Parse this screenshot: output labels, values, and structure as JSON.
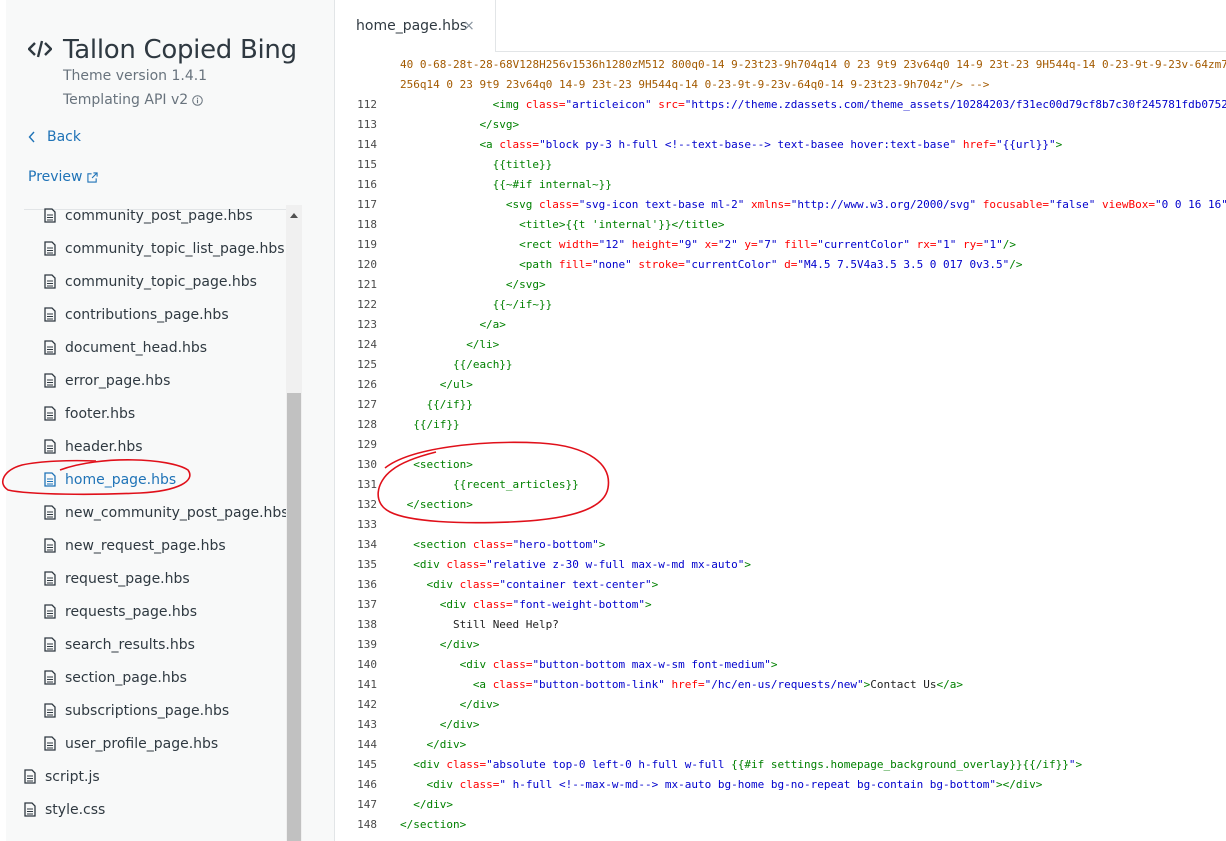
{
  "sidebar": {
    "theme_name": "Tallon Copied Bing",
    "version": "Theme version 1.4.1",
    "api": "Templating API v2",
    "back": "Back",
    "preview": "Preview",
    "files": [
      {
        "name": "community_post_page.hbs"
      },
      {
        "name": "community_topic_list_page.hbs"
      },
      {
        "name": "community_topic_page.hbs"
      },
      {
        "name": "contributions_page.hbs"
      },
      {
        "name": "document_head.hbs"
      },
      {
        "name": "error_page.hbs"
      },
      {
        "name": "footer.hbs"
      },
      {
        "name": "header.hbs"
      },
      {
        "name": "home_page.hbs",
        "selected": true
      },
      {
        "name": "new_community_post_page.hbs"
      },
      {
        "name": "new_request_page.hbs"
      },
      {
        "name": "request_page.hbs"
      },
      {
        "name": "requests_page.hbs"
      },
      {
        "name": "search_results.hbs"
      },
      {
        "name": "section_page.hbs"
      },
      {
        "name": "subscriptions_page.hbs"
      },
      {
        "name": "user_profile_page.hbs"
      }
    ],
    "root_files": [
      {
        "name": "script.js"
      },
      {
        "name": "style.css"
      }
    ]
  },
  "tabs": [
    {
      "label": "home_page.hbs",
      "close": "×"
    }
  ],
  "editor": {
    "lines": [
      {
        "n": "",
        "indent": 0,
        "tokens": [
          [
            "cmt",
            "40 0-68-28t-28-68V128H256v1536h1280zM512 800q0-14 9-23t23-9h704q14 0 23 9t9 23v64q0 14-9 23t-23 9H544q-14 0-23-9t-9-23v-64zm7"
          ]
        ]
      },
      {
        "n": "",
        "indent": 0,
        "tokens": [
          [
            "cmt",
            "256q14 0 23 9t9 23v64q0 14-9 23t-23 9H544q-14 0-23-9t-9-23v-64q0-14 9-23t23-9h704z\"/> -->"
          ]
        ]
      },
      {
        "n": "112",
        "indent": 14,
        "tokens": [
          [
            "tag",
            "<img "
          ],
          [
            "attr",
            "class="
          ],
          [
            "str",
            "\"articleicon\""
          ],
          [
            "txt",
            " "
          ],
          [
            "attr",
            "src="
          ],
          [
            "str",
            "\"https://theme.zdassets.com/theme_assets/10284203/f31ec00d79cf8b7c30f245781fdb0752"
          ]
        ]
      },
      {
        "n": "113",
        "indent": 12,
        "tokens": [
          [
            "tag",
            "</svg>"
          ]
        ]
      },
      {
        "n": "114",
        "indent": 12,
        "tokens": [
          [
            "tag",
            "<a "
          ],
          [
            "attr",
            "class="
          ],
          [
            "str",
            "\"block py-3 h-full <!--text-base--> text-basee hover:text-base\""
          ],
          [
            "txt",
            " "
          ],
          [
            "attr",
            "href="
          ],
          [
            "str",
            "\"{{url}}\""
          ],
          [
            "tag",
            ">"
          ]
        ]
      },
      {
        "n": "115",
        "indent": 14,
        "tokens": [
          [
            "hb",
            "{{title}}"
          ]
        ]
      },
      {
        "n": "116",
        "indent": 14,
        "tokens": [
          [
            "hb",
            "{{~#if internal~}}"
          ]
        ]
      },
      {
        "n": "117",
        "indent": 16,
        "tokens": [
          [
            "tag",
            "<svg "
          ],
          [
            "attr",
            "class="
          ],
          [
            "str",
            "\"svg-icon text-base ml-2\""
          ],
          [
            "txt",
            " "
          ],
          [
            "attr",
            "xmlns="
          ],
          [
            "str",
            "\"http://www.w3.org/2000/svg\""
          ],
          [
            "txt",
            " "
          ],
          [
            "attr",
            "focusable="
          ],
          [
            "str",
            "\"false\""
          ],
          [
            "txt",
            " "
          ],
          [
            "attr",
            "viewBox="
          ],
          [
            "str",
            "\"0 0 16 16\""
          ]
        ]
      },
      {
        "n": "118",
        "indent": 18,
        "tokens": [
          [
            "tag",
            "<title>"
          ],
          [
            "hb",
            "{{t 'internal'}}"
          ],
          [
            "tag",
            "</title>"
          ]
        ]
      },
      {
        "n": "119",
        "indent": 18,
        "tokens": [
          [
            "tag",
            "<rect "
          ],
          [
            "attr",
            "width="
          ],
          [
            "str",
            "\"12\""
          ],
          [
            "txt",
            " "
          ],
          [
            "attr",
            "height="
          ],
          [
            "str",
            "\"9\""
          ],
          [
            "txt",
            " "
          ],
          [
            "attr",
            "x="
          ],
          [
            "str",
            "\"2\""
          ],
          [
            "txt",
            " "
          ],
          [
            "attr",
            "y="
          ],
          [
            "str",
            "\"7\""
          ],
          [
            "txt",
            " "
          ],
          [
            "attr",
            "fill="
          ],
          [
            "str",
            "\"currentColor\""
          ],
          [
            "txt",
            " "
          ],
          [
            "attr",
            "rx="
          ],
          [
            "str",
            "\"1\""
          ],
          [
            "txt",
            " "
          ],
          [
            "attr",
            "ry="
          ],
          [
            "str",
            "\"1\""
          ],
          [
            "tag",
            "/>"
          ]
        ]
      },
      {
        "n": "120",
        "indent": 18,
        "tokens": [
          [
            "tag",
            "<path "
          ],
          [
            "attr",
            "fill="
          ],
          [
            "str",
            "\"none\""
          ],
          [
            "txt",
            " "
          ],
          [
            "attr",
            "stroke="
          ],
          [
            "str",
            "\"currentColor\""
          ],
          [
            "txt",
            " "
          ],
          [
            "attr",
            "d="
          ],
          [
            "str",
            "\"M4.5 7.5V4a3.5 3.5 0 017 0v3.5\""
          ],
          [
            "tag",
            "/>"
          ]
        ]
      },
      {
        "n": "121",
        "indent": 16,
        "tokens": [
          [
            "tag",
            "</svg>"
          ]
        ]
      },
      {
        "n": "122",
        "indent": 14,
        "tokens": [
          [
            "hb",
            "{{~/if~}}"
          ]
        ]
      },
      {
        "n": "123",
        "indent": 12,
        "tokens": [
          [
            "tag",
            "</a>"
          ]
        ]
      },
      {
        "n": "124",
        "indent": 10,
        "tokens": [
          [
            "tag",
            "</li>"
          ]
        ]
      },
      {
        "n": "125",
        "indent": 8,
        "tokens": [
          [
            "hb",
            "{{/each}}"
          ]
        ]
      },
      {
        "n": "126",
        "indent": 6,
        "tokens": [
          [
            "tag",
            "</ul>"
          ]
        ]
      },
      {
        "n": "127",
        "indent": 4,
        "tokens": [
          [
            "hb",
            "{{/if}}"
          ]
        ]
      },
      {
        "n": "128",
        "indent": 2,
        "tokens": [
          [
            "hb",
            "{{/if}}"
          ]
        ]
      },
      {
        "n": "129",
        "indent": 0,
        "tokens": []
      },
      {
        "n": "130",
        "indent": 2,
        "tokens": [
          [
            "tag",
            "<section>"
          ]
        ]
      },
      {
        "n": "131",
        "indent": 8,
        "tokens": [
          [
            "hb",
            "{{recent_articles}}"
          ]
        ]
      },
      {
        "n": "132",
        "indent": 1,
        "tokens": [
          [
            "tag",
            "</section>"
          ]
        ]
      },
      {
        "n": "133",
        "indent": 0,
        "tokens": []
      },
      {
        "n": "134",
        "indent": 2,
        "tokens": [
          [
            "tag",
            "<section "
          ],
          [
            "attr",
            "class="
          ],
          [
            "str",
            "\"hero-bottom\""
          ],
          [
            "tag",
            ">"
          ]
        ]
      },
      {
        "n": "135",
        "indent": 2,
        "tokens": [
          [
            "tag",
            "<div "
          ],
          [
            "attr",
            "class="
          ],
          [
            "str",
            "\"relative z-30 w-full max-w-md mx-auto\""
          ],
          [
            "tag",
            ">"
          ]
        ]
      },
      {
        "n": "136",
        "indent": 4,
        "tokens": [
          [
            "tag",
            "<div "
          ],
          [
            "attr",
            "class="
          ],
          [
            "str",
            "\"container text-center\""
          ],
          [
            "tag",
            ">"
          ]
        ]
      },
      {
        "n": "137",
        "indent": 6,
        "tokens": [
          [
            "tag",
            "<div "
          ],
          [
            "attr",
            "class="
          ],
          [
            "str",
            "\"font-weight-bottom\""
          ],
          [
            "tag",
            ">"
          ]
        ]
      },
      {
        "n": "138",
        "indent": 8,
        "tokens": [
          [
            "txt",
            "Still Need Help?"
          ]
        ]
      },
      {
        "n": "139",
        "indent": 6,
        "tokens": [
          [
            "tag",
            "</div>"
          ]
        ]
      },
      {
        "n": "140",
        "indent": 9,
        "tokens": [
          [
            "tag",
            "<div "
          ],
          [
            "attr",
            "class="
          ],
          [
            "str",
            "\"button-bottom max-w-sm font-medium\""
          ],
          [
            "tag",
            ">"
          ]
        ]
      },
      {
        "n": "141",
        "indent": 11,
        "tokens": [
          [
            "tag",
            "<a "
          ],
          [
            "attr",
            "class="
          ],
          [
            "str",
            "\"button-bottom-link\""
          ],
          [
            "txt",
            " "
          ],
          [
            "attr",
            "href="
          ],
          [
            "str",
            "\"/hc/en-us/requests/new\""
          ],
          [
            "tag",
            ">"
          ],
          [
            "txt",
            "Contact Us"
          ],
          [
            "tag",
            "</a>"
          ]
        ]
      },
      {
        "n": "142",
        "indent": 9,
        "tokens": [
          [
            "tag",
            "</div>"
          ]
        ]
      },
      {
        "n": "143",
        "indent": 6,
        "tokens": [
          [
            "tag",
            "</div>"
          ]
        ]
      },
      {
        "n": "144",
        "indent": 4,
        "tokens": [
          [
            "tag",
            "</div>"
          ]
        ]
      },
      {
        "n": "145",
        "indent": 2,
        "tokens": [
          [
            "tag",
            "<div "
          ],
          [
            "attr",
            "class="
          ],
          [
            "str",
            "\"absolute top-0 left-0 h-full w-full "
          ],
          [
            "hb",
            "{{#if settings.homepage_background_overlay}}{{/if}}"
          ],
          [
            "str",
            "\""
          ],
          [
            "tag",
            ">"
          ]
        ]
      },
      {
        "n": "146",
        "indent": 4,
        "tokens": [
          [
            "tag",
            "<div "
          ],
          [
            "attr",
            "class="
          ],
          [
            "str",
            "\" h-full <!--max-w-md--> mx-auto bg-home bg-no-repeat bg-contain bg-bottom\""
          ],
          [
            "tag",
            "></div>"
          ]
        ]
      },
      {
        "n": "147",
        "indent": 2,
        "tokens": [
          [
            "tag",
            "</div>"
          ]
        ]
      },
      {
        "n": "148",
        "indent": 0,
        "tokens": [
          [
            "tag",
            "</section>"
          ]
        ]
      }
    ]
  },
  "colors": {
    "accent": "#1f73b7",
    "annotation": "#e0101a",
    "tag": "#008000",
    "attr": "#ff0000",
    "string": "#0000cc"
  }
}
